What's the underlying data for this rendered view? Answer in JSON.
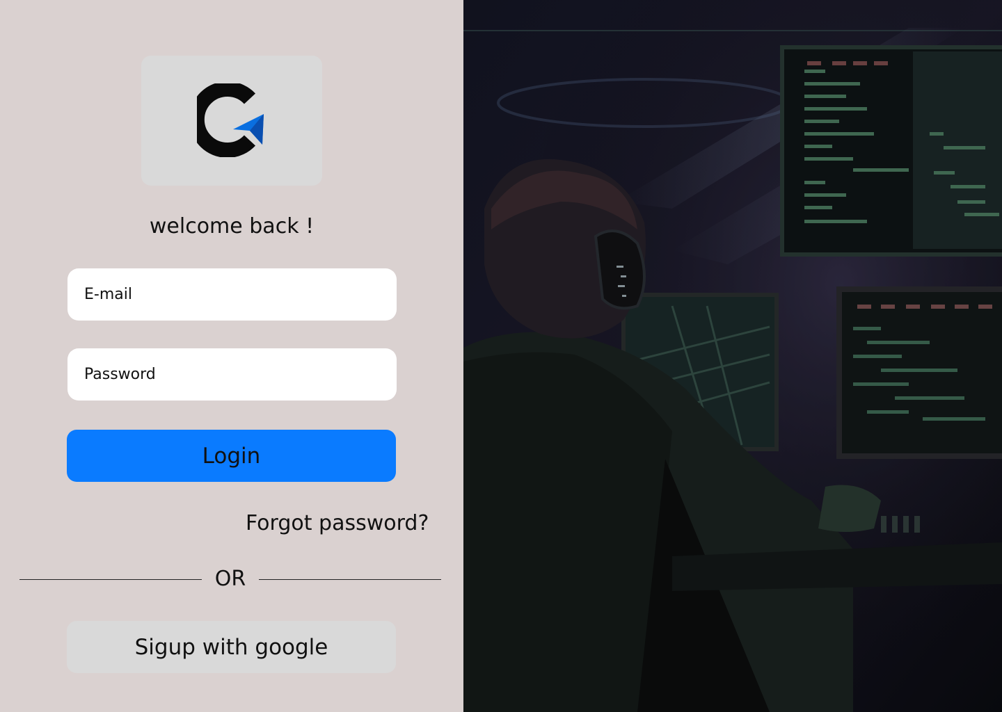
{
  "brand": {
    "logo_icon": "logo-c-arrow-icon",
    "accent": "#0a7bff"
  },
  "auth": {
    "welcome": "welcome back !",
    "email_placeholder": "E-mail",
    "password_placeholder": "Password",
    "login_label": "Login",
    "forgot_label": "Forgot password?",
    "divider_label": "OR",
    "google_label": "Sigup with google"
  },
  "colors": {
    "panel_bg": "#dad1d0",
    "field_bg": "#ffffff",
    "button_primary": "#0a7bff",
    "button_secondary": "#d9d9d9"
  }
}
